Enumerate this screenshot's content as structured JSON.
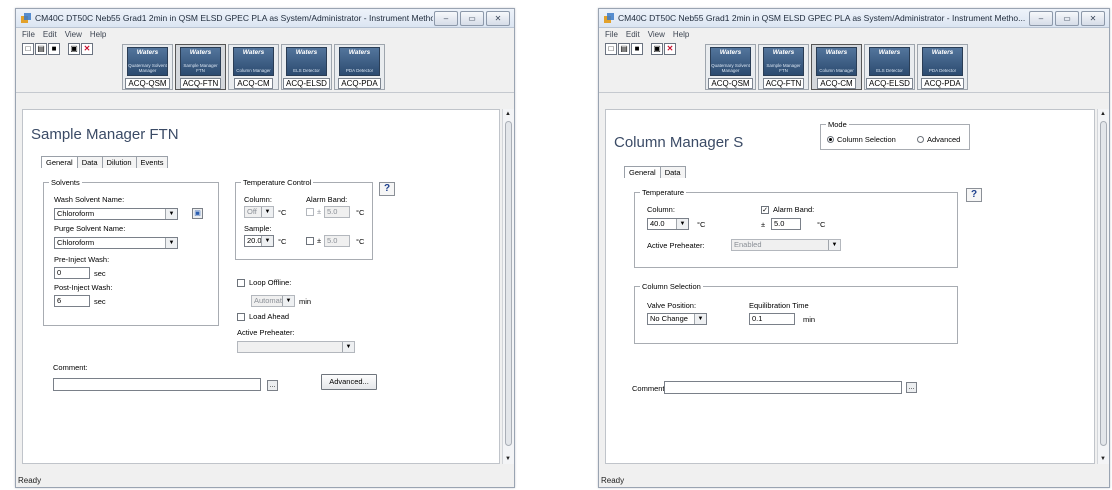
{
  "windows": [
    {
      "title": "CM40C DT50C Neb55 Grad1 2min in QSM ELSD GPEC PLA as System/Administrator - Instrument Metho...",
      "menu": [
        "File",
        "Edit",
        "View",
        "Help"
      ],
      "modules": [
        {
          "brand": "Waters",
          "sub": "Quaternary Solvent Manager",
          "label": "ACQ-QSM"
        },
        {
          "brand": "Waters",
          "sub": "Sample Manager FTN",
          "label": "ACQ-FTN",
          "selected": true
        },
        {
          "brand": "Waters",
          "sub": "Column Manager",
          "label": "ACQ-CM"
        },
        {
          "brand": "Waters",
          "sub": "ELS Detector",
          "label": "ACQ-ELSD"
        },
        {
          "brand": "Waters",
          "sub": "PDA Detector",
          "label": "ACQ-PDA"
        }
      ],
      "heading": "Sample Manager FTN",
      "tabs": [
        "General",
        "Data",
        "Dilution",
        "Events"
      ],
      "solvents": {
        "group": "Solvents",
        "wash_label": "Wash Solvent Name:",
        "wash_value": "Chloroform",
        "purge_label": "Purge Solvent Name:",
        "purge_value": "Chloroform",
        "preinject_label": "Pre-Inject Wash:",
        "preinject_value": "0",
        "postinject_label": "Post-Inject Wash:",
        "postinject_value": "6",
        "unit": "sec"
      },
      "temperature": {
        "group": "Temperature Control",
        "column_label": "Column:",
        "column_value": "Off",
        "alarm_label": "Alarm Band:",
        "alarm_value": "5.0",
        "sample_label": "Sample:",
        "sample_value": "20.0",
        "sample_alarm_value": "5.0",
        "unit": "°C",
        "pm": "±"
      },
      "loop_offline": "Loop Offline:",
      "loop_mode": "Automatic",
      "loop_unit": "min",
      "load_ahead": "Load Ahead",
      "active_preheater_label": "Active Preheater:",
      "active_preheater_value": "",
      "comment_label": "Comment:",
      "comment_value": "",
      "browse": "...",
      "advanced": "Advanced...",
      "help": "?",
      "status": "Ready"
    },
    {
      "title": "CM40C DT50C Neb55 Grad1 2min in QSM ELSD GPEC PLA as System/Administrator - Instrument Metho...",
      "menu": [
        "File",
        "Edit",
        "View",
        "Help"
      ],
      "modules": [
        {
          "brand": "Waters",
          "sub": "Quaternary Solvent Manager",
          "label": "ACQ-QSM"
        },
        {
          "brand": "Waters",
          "sub": "Sample Manager FTN",
          "label": "ACQ-FTN"
        },
        {
          "brand": "Waters",
          "sub": "Column Manager",
          "label": "ACQ-CM",
          "selected": true
        },
        {
          "brand": "Waters",
          "sub": "ELS Detector",
          "label": "ACQ-ELSD"
        },
        {
          "brand": "Waters",
          "sub": "PDA Detector",
          "label": "ACQ-PDA"
        }
      ],
      "heading": "Column Manager S",
      "mode": {
        "group": "Mode",
        "option1": "Column Selection",
        "option2": "Advanced"
      },
      "tabs": [
        "General",
        "Data"
      ],
      "temperature": {
        "group": "Temperature",
        "column_label": "Column:",
        "column_value": "40.0",
        "unit": "°C",
        "alarm_label": "Alarm Band:",
        "alarm_value": "5.0",
        "pm": "±",
        "preheater_label": "Active Preheater:",
        "preheater_value": "Enabled"
      },
      "column_selection": {
        "group": "Column Selection",
        "valve_label": "Valve Position:",
        "valve_value": "No Change",
        "equil_label": "Equilibration Time",
        "equil_value": "0.1",
        "equil_unit": "min"
      },
      "comment_label": "Comment:",
      "comment_value": "",
      "browse": "...",
      "help": "?",
      "status": "Ready"
    }
  ],
  "colors": {
    "heading": "#3b4b66",
    "module_bg": "#2c4b70",
    "help": "#1c3f8c"
  }
}
